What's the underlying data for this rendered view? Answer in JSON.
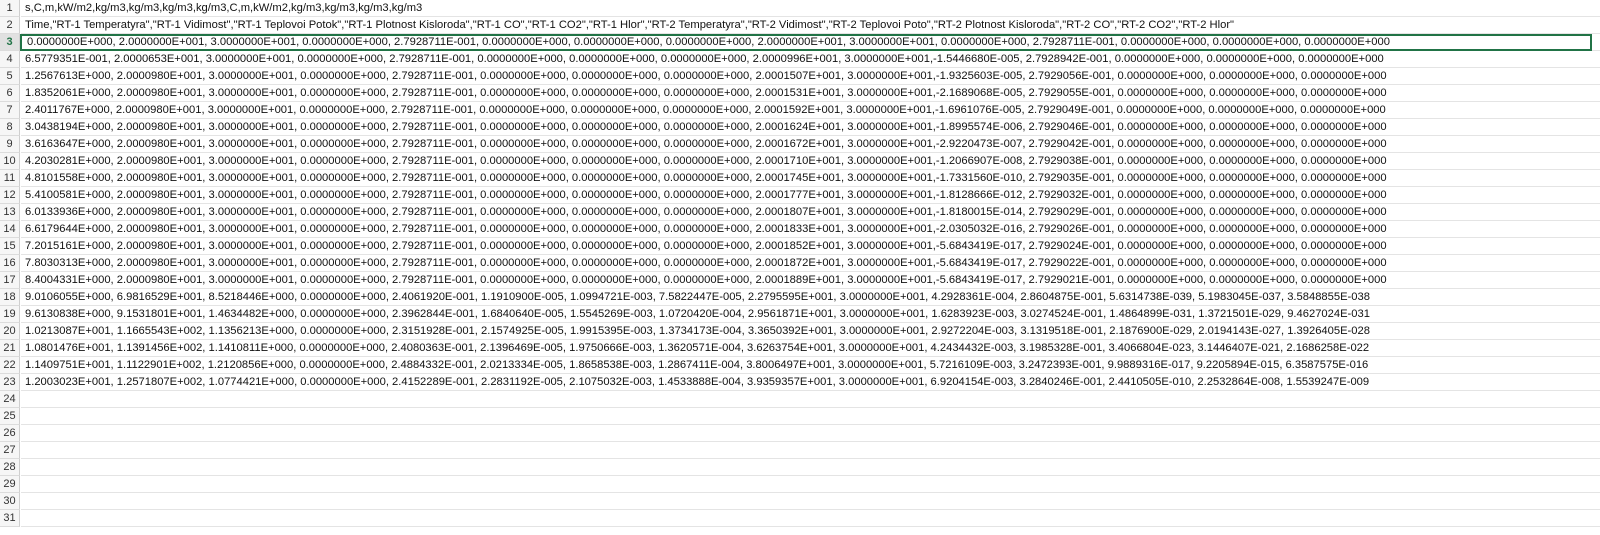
{
  "sheet": {
    "selected_row": 3,
    "rows": [
      {
        "n": "1",
        "text": "s,C,m,kW/m2,kg/m3,kg/m3,kg/m3,kg/m3,C,m,kW/m2,kg/m3,kg/m3,kg/m3,kg/m3"
      },
      {
        "n": "2",
        "text": "Time,\"RT-1 Temperatyra\",\"RT-1 Vidimost\",\"RT-1 Teplovoi Potok\",\"RT-1 Plotnost Kisloroda\",\"RT-1 CO\",\"RT-1 CO2\",\"RT-1 Hlor\",\"RT-2 Temperatyra\",\"RT-2 Vidimost\",\"RT-2 Teplovoi Poto\",\"RT-2 Plotnost Kisloroda\",\"RT-2 CO\",\"RT-2 CO2\",\"RT-2 Hlor\""
      },
      {
        "n": "3",
        "text": "0.0000000E+000, 2.0000000E+001, 3.0000000E+001, 0.0000000E+000, 2.7928711E-001, 0.0000000E+000, 0.0000000E+000, 0.0000000E+000, 2.0000000E+001, 3.0000000E+001, 0.0000000E+000, 2.7928711E-001, 0.0000000E+000, 0.0000000E+000, 0.0000000E+000"
      },
      {
        "n": "4",
        "text": "6.5779351E-001, 2.0000653E+001, 3.0000000E+001, 0.0000000E+000, 2.7928711E-001, 0.0000000E+000, 0.0000000E+000, 0.0000000E+000, 2.0000996E+001, 3.0000000E+001,-1.5446680E-005, 2.7928942E-001, 0.0000000E+000, 0.0000000E+000, 0.0000000E+000"
      },
      {
        "n": "5",
        "text": "1.2567613E+000, 2.0000980E+001, 3.0000000E+001, 0.0000000E+000, 2.7928711E-001, 0.0000000E+000, 0.0000000E+000, 0.0000000E+000, 2.0001507E+001, 3.0000000E+001,-1.9325603E-005, 2.7929056E-001, 0.0000000E+000, 0.0000000E+000, 0.0000000E+000"
      },
      {
        "n": "6",
        "text": "1.8352061E+000, 2.0000980E+001, 3.0000000E+001, 0.0000000E+000, 2.7928711E-001, 0.0000000E+000, 0.0000000E+000, 0.0000000E+000, 2.0001531E+001, 3.0000000E+001,-2.1689068E-005, 2.7929055E-001, 0.0000000E+000, 0.0000000E+000, 0.0000000E+000"
      },
      {
        "n": "7",
        "text": "2.4011767E+000, 2.0000980E+001, 3.0000000E+001, 0.0000000E+000, 2.7928711E-001, 0.0000000E+000, 0.0000000E+000, 0.0000000E+000, 2.0001592E+001, 3.0000000E+001,-1.6961076E-005, 2.7929049E-001, 0.0000000E+000, 0.0000000E+000, 0.0000000E+000"
      },
      {
        "n": "8",
        "text": "3.0438194E+000, 2.0000980E+001, 3.0000000E+001, 0.0000000E+000, 2.7928711E-001, 0.0000000E+000, 0.0000000E+000, 0.0000000E+000, 2.0001624E+001, 3.0000000E+001,-1.8995574E-006, 2.7929046E-001, 0.0000000E+000, 0.0000000E+000, 0.0000000E+000"
      },
      {
        "n": "9",
        "text": "3.6163647E+000, 2.0000980E+001, 3.0000000E+001, 0.0000000E+000, 2.7928711E-001, 0.0000000E+000, 0.0000000E+000, 0.0000000E+000, 2.0001672E+001, 3.0000000E+001,-2.9220473E-007, 2.7929042E-001, 0.0000000E+000, 0.0000000E+000, 0.0000000E+000"
      },
      {
        "n": "10",
        "text": "4.2030281E+000, 2.0000980E+001, 3.0000000E+001, 0.0000000E+000, 2.7928711E-001, 0.0000000E+000, 0.0000000E+000, 0.0000000E+000, 2.0001710E+001, 3.0000000E+001,-1.2066907E-008, 2.7929038E-001, 0.0000000E+000, 0.0000000E+000, 0.0000000E+000"
      },
      {
        "n": "11",
        "text": "4.8101558E+000, 2.0000980E+001, 3.0000000E+001, 0.0000000E+000, 2.7928711E-001, 0.0000000E+000, 0.0000000E+000, 0.0000000E+000, 2.0001745E+001, 3.0000000E+001,-1.7331560E-010, 2.7929035E-001, 0.0000000E+000, 0.0000000E+000, 0.0000000E+000"
      },
      {
        "n": "12",
        "text": "5.4100581E+000, 2.0000980E+001, 3.0000000E+001, 0.0000000E+000, 2.7928711E-001, 0.0000000E+000, 0.0000000E+000, 0.0000000E+000, 2.0001777E+001, 3.0000000E+001,-1.8128666E-012, 2.7929032E-001, 0.0000000E+000, 0.0000000E+000, 0.0000000E+000"
      },
      {
        "n": "13",
        "text": "6.0133936E+000, 2.0000980E+001, 3.0000000E+001, 0.0000000E+000, 2.7928711E-001, 0.0000000E+000, 0.0000000E+000, 0.0000000E+000, 2.0001807E+001, 3.0000000E+001,-1.8180015E-014, 2.7929029E-001, 0.0000000E+000, 0.0000000E+000, 0.0000000E+000"
      },
      {
        "n": "14",
        "text": "6.6179644E+000, 2.0000980E+001, 3.0000000E+001, 0.0000000E+000, 2.7928711E-001, 0.0000000E+000, 0.0000000E+000, 0.0000000E+000, 2.0001833E+001, 3.0000000E+001,-2.0305032E-016, 2.7929026E-001, 0.0000000E+000, 0.0000000E+000, 0.0000000E+000"
      },
      {
        "n": "15",
        "text": "7.2015161E+000, 2.0000980E+001, 3.0000000E+001, 0.0000000E+000, 2.7928711E-001, 0.0000000E+000, 0.0000000E+000, 0.0000000E+000, 2.0001852E+001, 3.0000000E+001,-5.6843419E-017, 2.7929024E-001, 0.0000000E+000, 0.0000000E+000, 0.0000000E+000"
      },
      {
        "n": "16",
        "text": "7.8030313E+000, 2.0000980E+001, 3.0000000E+001, 0.0000000E+000, 2.7928711E-001, 0.0000000E+000, 0.0000000E+000, 0.0000000E+000, 2.0001872E+001, 3.0000000E+001,-5.6843419E-017, 2.7929022E-001, 0.0000000E+000, 0.0000000E+000, 0.0000000E+000"
      },
      {
        "n": "17",
        "text": "8.4004331E+000, 2.0000980E+001, 3.0000000E+001, 0.0000000E+000, 2.7928711E-001, 0.0000000E+000, 0.0000000E+000, 0.0000000E+000, 2.0001889E+001, 3.0000000E+001,-5.6843419E-017, 2.7929021E-001, 0.0000000E+000, 0.0000000E+000, 0.0000000E+000"
      },
      {
        "n": "18",
        "text": "9.0106055E+000, 6.9816529E+001, 8.5218446E+000, 0.0000000E+000, 2.4061920E-001, 1.1910900E-005, 1.0994721E-003, 7.5822447E-005, 2.2795595E+001, 3.0000000E+001, 4.2928361E-004, 2.8604875E-001, 5.6314738E-039, 5.1983045E-037, 3.5848855E-038"
      },
      {
        "n": "19",
        "text": "9.6130838E+000, 9.1531801E+001, 1.4634482E+000, 0.0000000E+000, 2.3962844E-001, 1.6840640E-005, 1.5545269E-003, 1.0720420E-004, 2.9561871E+001, 3.0000000E+001, 1.6283923E-003, 3.0274524E-001, 1.4864899E-031, 1.3721501E-029, 9.4627024E-031"
      },
      {
        "n": "20",
        "text": "1.0213087E+001, 1.1665543E+002, 1.1356213E+000, 0.0000000E+000, 2.3151928E-001, 2.1574925E-005, 1.9915395E-003, 1.3734173E-004, 3.3650392E+001, 3.0000000E+001, 2.9272204E-003, 3.1319518E-001, 2.1876900E-029, 2.0194143E-027, 1.3926405E-028"
      },
      {
        "n": "21",
        "text": "1.0801476E+001, 1.1391456E+002, 1.1410811E+000, 0.0000000E+000, 2.4080363E-001, 2.1396469E-005, 1.9750666E-003, 1.3620571E-004, 3.6263754E+001, 3.0000000E+001, 4.2434432E-003, 3.1985328E-001, 3.4066804E-023, 3.1446407E-021, 2.1686258E-022"
      },
      {
        "n": "22",
        "text": "1.1409751E+001, 1.1122901E+002, 1.2120856E+000, 0.0000000E+000, 2.4884332E-001, 2.0213334E-005, 1.8658538E-003, 1.2867411E-004, 3.8006497E+001, 3.0000000E+001, 5.7216109E-003, 3.2472393E-001, 9.9889316E-017, 9.2205894E-015, 6.3587575E-016"
      },
      {
        "n": "23",
        "text": "1.2003023E+001, 1.2571807E+002, 1.0774421E+000, 0.0000000E+000, 2.4152289E-001, 2.2831192E-005, 2.1075032E-003, 1.4533888E-004, 3.9359357E+001, 3.0000000E+001, 6.9204154E-003, 3.2840246E-001, 2.4410505E-010, 2.2532864E-008, 1.5539247E-009"
      },
      {
        "n": "24",
        "text": ""
      },
      {
        "n": "25",
        "text": ""
      },
      {
        "n": "26",
        "text": ""
      },
      {
        "n": "27",
        "text": ""
      },
      {
        "n": "28",
        "text": ""
      },
      {
        "n": "29",
        "text": ""
      },
      {
        "n": "30",
        "text": ""
      },
      {
        "n": "31",
        "text": ""
      }
    ]
  }
}
